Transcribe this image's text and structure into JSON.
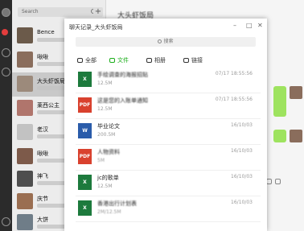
{
  "sidebar": {
    "search_placeholder": "Search",
    "add_label": "+",
    "chats": [
      {
        "name": "Bence",
        "avatar_color": "#6b5a4a"
      },
      {
        "name": "啾啾",
        "avatar_color": "#8a6d5c"
      },
      {
        "name": "大头虾饭局",
        "avatar_color": "#9c8a7b"
      },
      {
        "name": "莱西公主",
        "avatar_color": "#b0756c"
      },
      {
        "name": "老汉",
        "avatar_color": "#c2c2c2"
      },
      {
        "name": "啾啾",
        "avatar_color": "#7d5a4a"
      },
      {
        "name": "神飞",
        "avatar_color": "#4e4e4e"
      },
      {
        "name": "庆节",
        "avatar_color": "#9a6e51"
      },
      {
        "name": "大饼",
        "avatar_color": "#6f7d88"
      }
    ]
  },
  "chat": {
    "title": "大头虾饭局"
  },
  "modal": {
    "title": "聊天记录_大头虾饭局",
    "search_placeholder": "搜索",
    "tabs": [
      {
        "label": "全部",
        "icon": "all-icon"
      },
      {
        "label": "文件",
        "icon": "file-icon"
      },
      {
        "label": "相册",
        "icon": "photo-icon"
      },
      {
        "label": "链接",
        "icon": "link-icon"
      }
    ],
    "active_tab": "文件",
    "files": [
      {
        "type": "X",
        "color": "#1d7a3d",
        "name": "手绘调查的海报招贴",
        "size": "12.5M",
        "date": "07/17 18:55:56"
      },
      {
        "type": "PDF",
        "color": "#d9412e",
        "name": "这是您的入账单通知",
        "size": "12.5M",
        "date": "07/17 18:55:56"
      },
      {
        "type": "W",
        "color": "#2a5caa",
        "name": "毕业论文",
        "size": "200.5M",
        "date": "16/10/03"
      },
      {
        "type": "PDF",
        "color": "#d9412e",
        "name": "人物资料",
        "size": "5M",
        "date": "16/10/03"
      },
      {
        "type": "X",
        "color": "#1d7a3d",
        "name": "jc的歌单",
        "size": "12.5M",
        "date": "16/10/03"
      },
      {
        "type": "X",
        "color": "#1d7a3d",
        "name": "香港出行计划表",
        "size": "2M/12.5M",
        "date": "16/10/03"
      }
    ]
  },
  "colors": {
    "accent": "#1aad19",
    "bubble": "#9ee35f",
    "rail": "#2b2b2b"
  }
}
